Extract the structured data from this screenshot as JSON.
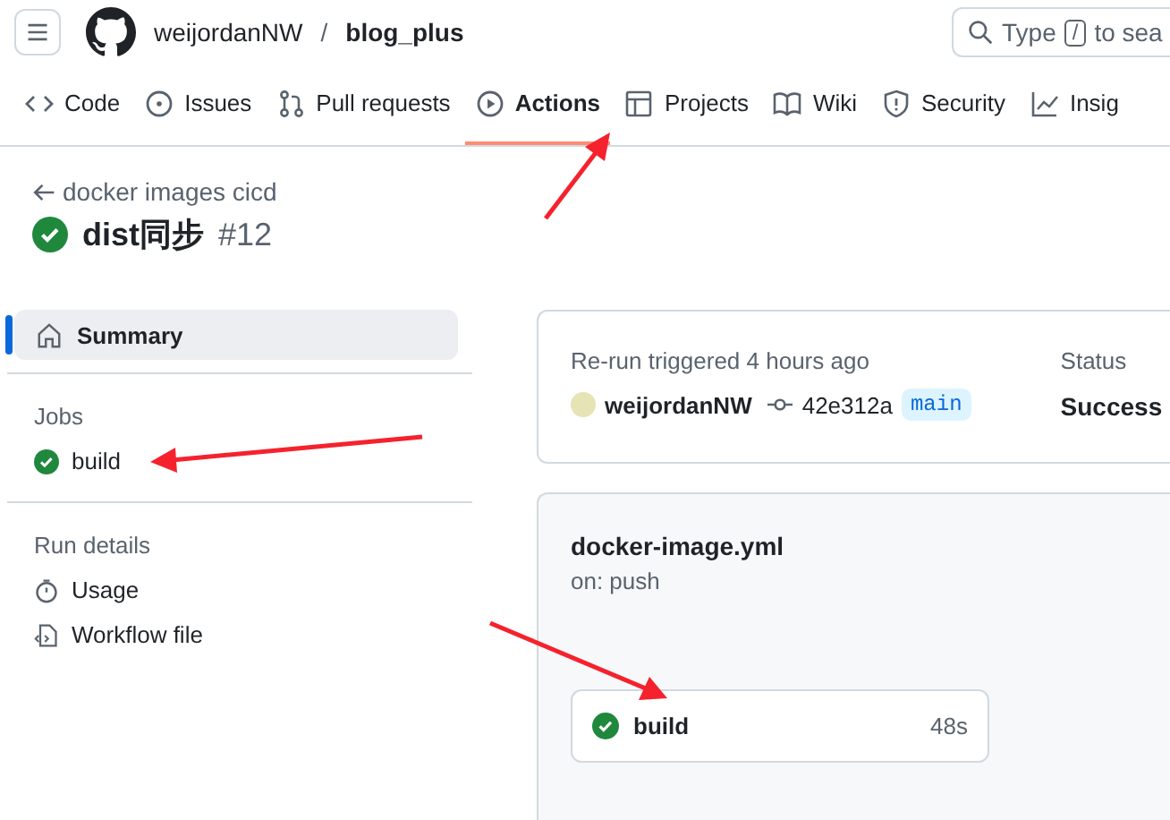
{
  "header": {
    "owner": "weijordanNW",
    "separator": "/",
    "repo": "blog_plus",
    "search": {
      "placeholder_start": "Type",
      "shortcut": "/",
      "placeholder_end": "to sea"
    }
  },
  "tabs": [
    {
      "label": "Code",
      "selected": false
    },
    {
      "label": "Issues",
      "selected": false
    },
    {
      "label": "Pull requests",
      "selected": false
    },
    {
      "label": "Actions",
      "selected": true
    },
    {
      "label": "Projects",
      "selected": false
    },
    {
      "label": "Wiki",
      "selected": false
    },
    {
      "label": "Security",
      "selected": false
    },
    {
      "label": "Insig",
      "selected": false
    }
  ],
  "run": {
    "back_link": "docker images cicd",
    "passed": true,
    "title": "dist同步",
    "number": "#12"
  },
  "sidebar": {
    "summary": {
      "label": "Summary",
      "selected": true
    },
    "groups": [
      {
        "heading": "Jobs",
        "items": [
          {
            "kind": "job",
            "label": "build",
            "passed": true
          }
        ]
      },
      {
        "heading": "Run details",
        "items": [
          {
            "kind": "link",
            "label": "Usage"
          },
          {
            "kind": "link",
            "label": "Workflow file"
          }
        ]
      }
    ]
  },
  "summary_card": {
    "trigger": "Re-run triggered 4 hours ago",
    "actor": "weijordanNW",
    "commit": "42e312a",
    "branch": "main",
    "status_label": "Status",
    "status_value": "Success"
  },
  "workflow_card": {
    "file": "docker-image.yml",
    "trigger": "on: push",
    "jobs": [
      {
        "name": "build",
        "passed": true,
        "duration": "48s"
      }
    ]
  }
}
